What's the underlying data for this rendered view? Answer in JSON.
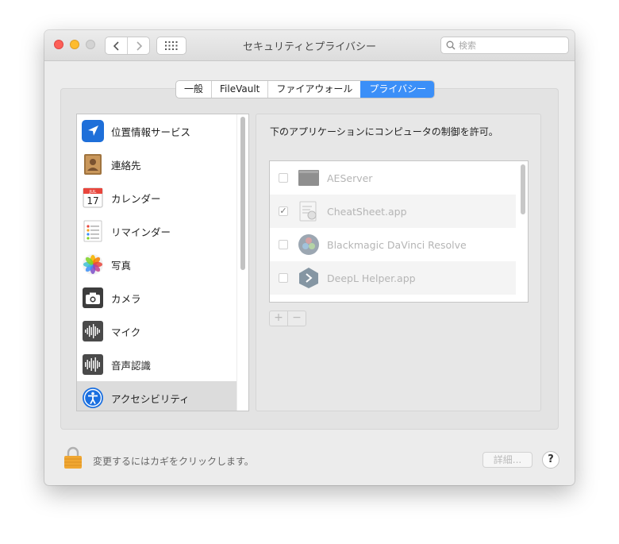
{
  "window": {
    "title": "セキュリティとプライバシー",
    "search_placeholder": "検索"
  },
  "tabs": [
    {
      "label": "一般",
      "active": false
    },
    {
      "label": "FileVault",
      "active": false
    },
    {
      "label": "ファイアウォール",
      "active": false
    },
    {
      "label": "プライバシー",
      "active": true
    }
  ],
  "sidebar": {
    "items": [
      {
        "label": "位置情報サービス",
        "icon": "location-arrow-icon"
      },
      {
        "label": "連絡先",
        "icon": "contacts-book-icon"
      },
      {
        "label": "カレンダー",
        "icon": "calendar-icon",
        "icon_month": "JUL",
        "icon_day": "17"
      },
      {
        "label": "リマインダー",
        "icon": "reminders-icon"
      },
      {
        "label": "写真",
        "icon": "photos-icon"
      },
      {
        "label": "カメラ",
        "icon": "camera-icon"
      },
      {
        "label": "マイク",
        "icon": "microphone-waveform-icon"
      },
      {
        "label": "音声認識",
        "icon": "speech-recognition-icon"
      },
      {
        "label": "アクセシビリティ",
        "icon": "accessibility-icon",
        "selected": true
      }
    ]
  },
  "main": {
    "description": "下のアプリケーションにコンピュータの制御を許可。",
    "apps": [
      {
        "name": "AEServer",
        "checked": false,
        "icon": "aeserver-icon"
      },
      {
        "name": "CheatSheet.app",
        "checked": true,
        "icon": "cheatsheet-icon"
      },
      {
        "name": "Blackmagic DaVinci Resolve",
        "checked": false,
        "icon": "davinci-resolve-icon"
      },
      {
        "name": "DeepL Helper.app",
        "checked": false,
        "icon": "deepl-icon"
      }
    ],
    "add_label": "+",
    "remove_label": "−"
  },
  "footer": {
    "lock_text": "変更するにはカギをクリックします。",
    "details_label": "詳細...",
    "help_label": "?"
  },
  "colors": {
    "accent": "#3b8ff8",
    "close": "#fd5f57",
    "minimize": "#febc2e",
    "disabled": "#d3d3d3"
  }
}
